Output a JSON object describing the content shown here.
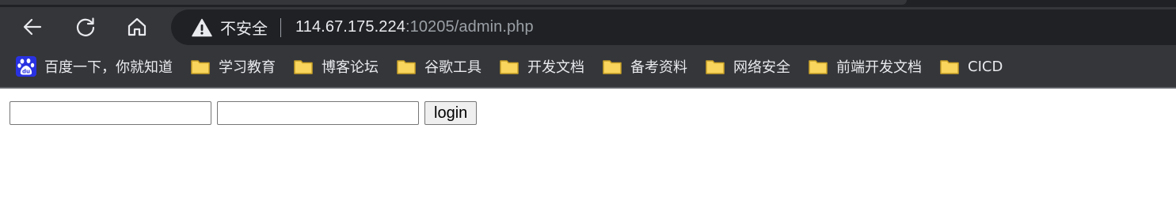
{
  "browser": {
    "security_label": "不安全",
    "url_host": "114.67.175.224",
    "url_rest": ":10205/admin.php",
    "nav": {
      "back_icon": "back-arrow-icon",
      "reload_icon": "reload-icon",
      "home_icon": "home-icon"
    },
    "bookmarks": [
      {
        "label": "百度一下，你就知道",
        "icon": "baidu-paw-icon"
      },
      {
        "label": "学习教育",
        "icon": "folder-icon"
      },
      {
        "label": "博客论坛",
        "icon": "folder-icon"
      },
      {
        "label": "谷歌工具",
        "icon": "folder-icon"
      },
      {
        "label": "开发文档",
        "icon": "folder-icon"
      },
      {
        "label": "备考资料",
        "icon": "folder-icon"
      },
      {
        "label": "网络安全",
        "icon": "folder-icon"
      },
      {
        "label": "前端开发文档",
        "icon": "folder-icon"
      },
      {
        "label": "CICD",
        "icon": "folder-icon"
      }
    ]
  },
  "page": {
    "username_value": "",
    "password_value": "",
    "login_label": "login"
  },
  "colors": {
    "chrome_bg": "#35363a",
    "omnibox_bg": "#202124",
    "folder_yellow": "#f9d55d"
  }
}
